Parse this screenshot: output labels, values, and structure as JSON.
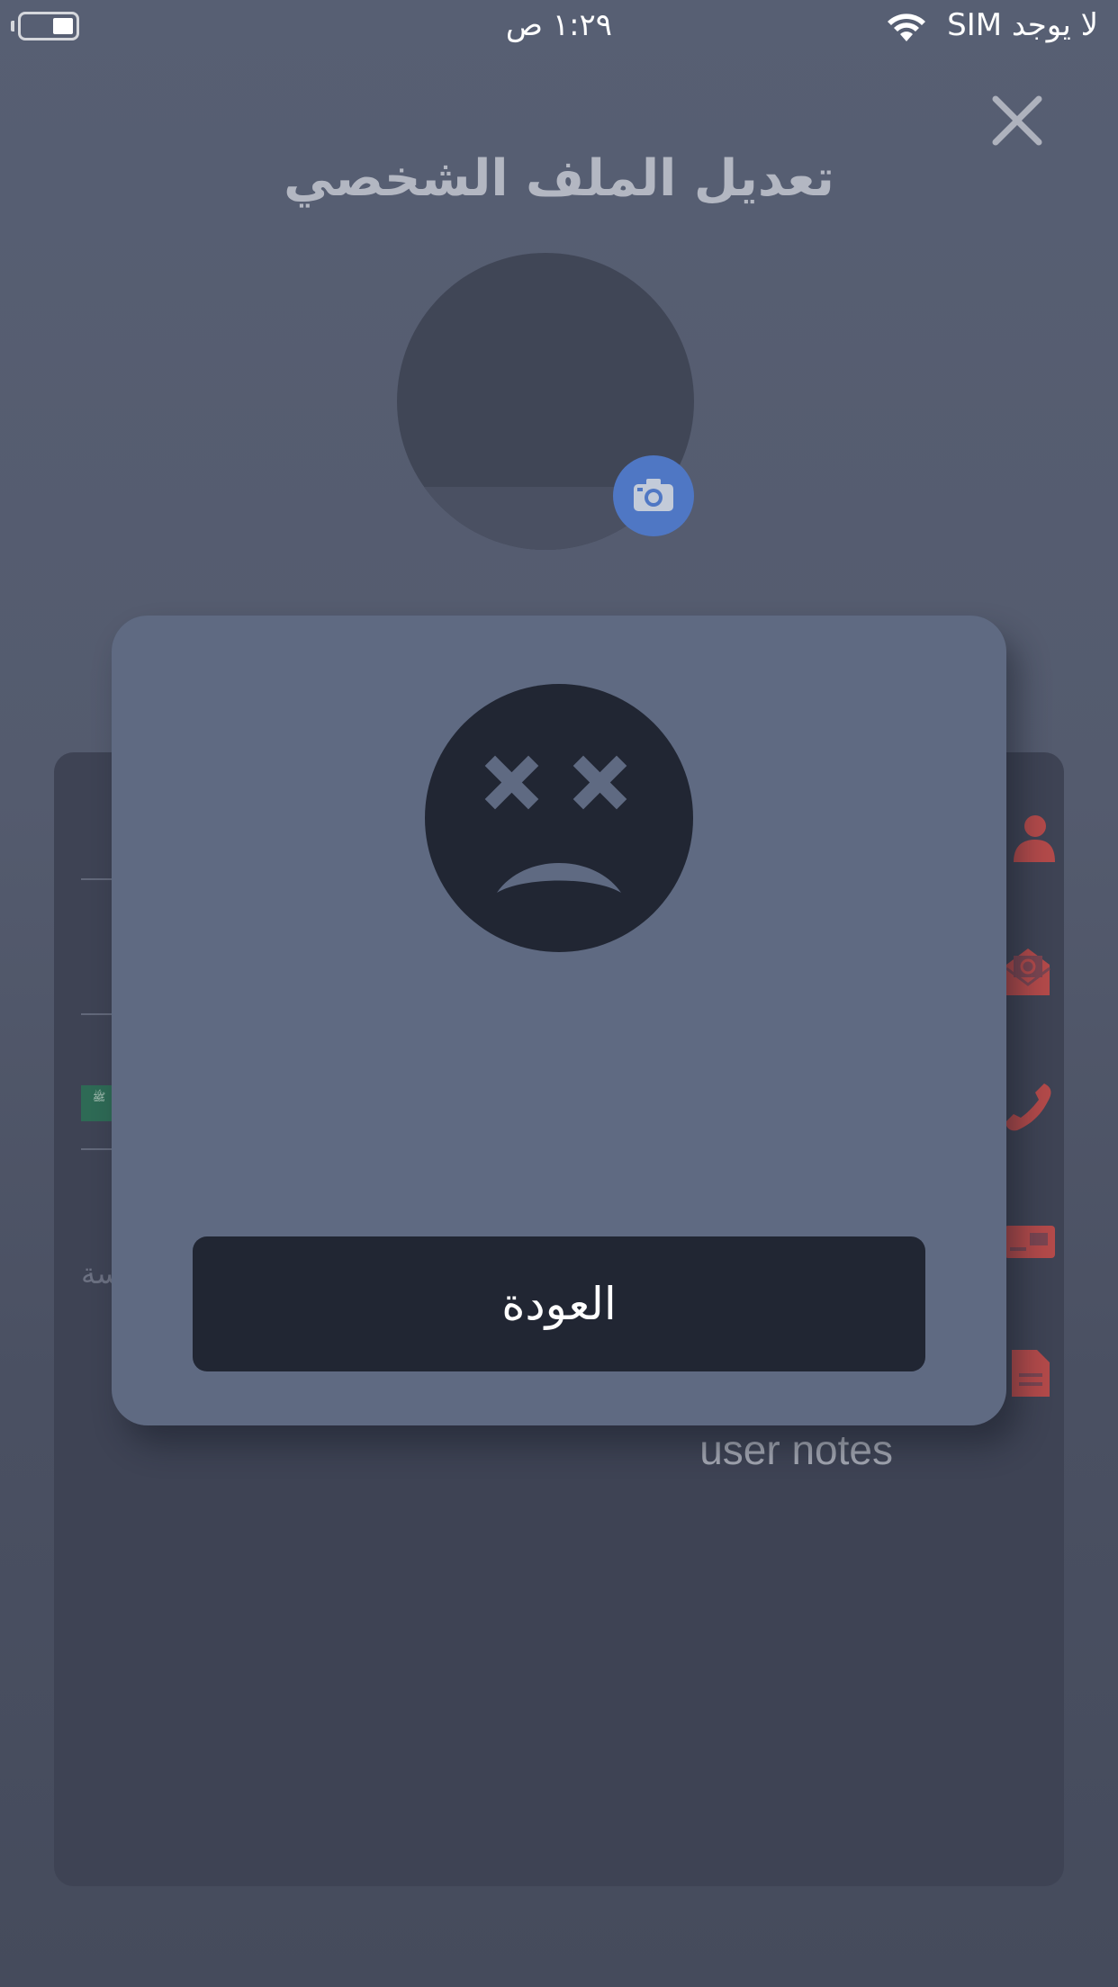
{
  "status_bar": {
    "time": "١:٢٩ ص",
    "carrier": "لا يوجد SIM"
  },
  "header": {
    "title": "تعديل الملف الشخصي"
  },
  "form": {
    "flag_text": "ﷺ",
    "placeholder_fragment": "سة",
    "notes_label": "user notes"
  },
  "modal": {
    "button_label": "العودة"
  },
  "colors": {
    "accent_camera": "#4f77c4",
    "icon_red": "#b34a4a",
    "modal_bg": "#5f6a82",
    "button_bg": "#212633"
  }
}
